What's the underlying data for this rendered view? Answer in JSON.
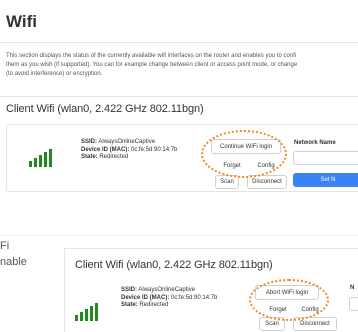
{
  "top": {
    "title": "Wifi",
    "description_lines": [
      "This section displays the status of the currently available wifi interfaces on the router and enables you to confi",
      "them as you wish (if supported). You can for example change between client or access point mode, or change",
      "(to avoid interference) or encryption."
    ],
    "section_title": "Client Wifi (wlan0, 2.422 GHz 802.11bgn)",
    "ssid_label": "SSID:",
    "ssid_value": "AlwaysOnlineCaptive",
    "mac_label": "Device ID (MAC):",
    "mac_value": "0c:fe:5d:90:14:7b",
    "state_label": "State:",
    "state_value": "Redirected",
    "login_button": "Continue WiFi login",
    "forget_button": "Forget",
    "config_button": "Config",
    "scan_button": "Scan",
    "disconnect_button": "Disconnect",
    "network_name_label": "Network Name",
    "set_button": "Set N"
  },
  "side_fragments": {
    "line1": "Fi",
    "line2": "nable"
  },
  "bottom": {
    "section_title": "Client Wifi (wlan0, 2.422 GHz 802.11bgn)",
    "ssid_label": "SSID:",
    "ssid_value": "AlwaysOnlineCaptive",
    "mac_label": "Device ID (MAC):",
    "mac_value": "0c:fe:5d:90:14:7b",
    "state_label": "State:",
    "state_value": "Redirected",
    "login_button": "Abort WiFi login",
    "forget_button": "Forget",
    "config_button": "Config",
    "scan_button": "Scan",
    "disconnect_button": "Disconnect",
    "network_initial": "N"
  },
  "colors": {
    "signal_green": "#1f8a1f",
    "callout_orange": "#f08a24",
    "primary_blue": "#3b82f6"
  }
}
